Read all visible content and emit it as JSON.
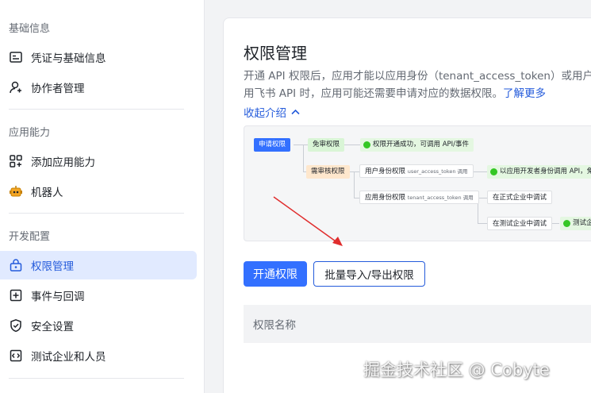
{
  "sidebar": {
    "sections": [
      {
        "title": "基础信息",
        "items": [
          {
            "label": "凭证与基础信息",
            "icon": "credential-icon"
          },
          {
            "label": "协作者管理",
            "icon": "user-add-icon"
          }
        ]
      },
      {
        "title": "应用能力",
        "items": [
          {
            "label": "添加应用能力",
            "icon": "grid-add-icon"
          },
          {
            "label": "机器人",
            "icon": "robot-icon"
          }
        ]
      },
      {
        "title": "开发配置",
        "items": [
          {
            "label": "权限管理",
            "icon": "lock-icon",
            "active": true
          },
          {
            "label": "事件与回调",
            "icon": "event-icon"
          },
          {
            "label": "安全设置",
            "icon": "shield-icon"
          },
          {
            "label": "测试企业和人员",
            "icon": "code-icon"
          }
        ]
      }
    ]
  },
  "main": {
    "title": "权限管理",
    "desc_line1": "开通 API 权限后，应用才能以应用身份（tenant_access_token）或用户",
    "desc_line2": "用飞书 API 时，应用可能还需要申请对应的数据权限。",
    "learn_more": "了解更多",
    "collapse_label": "收起介绍",
    "flow": {
      "apply": "申请权限",
      "no_review": "免审权限",
      "no_review_result": "权限开通成功，可调用 API/事件",
      "need_review": "需审核权限",
      "user_identity": "用户身份权限",
      "user_token": "user_access_token 调用",
      "user_result": "以应用开发者身份调用 API，免",
      "app_identity": "应用身份权限",
      "app_token": "tenant_access_token 调用",
      "prod_debug": "在正式企业中调试",
      "test_debug": "在测试企业中调试",
      "test_result": "测试企"
    },
    "enable_button": "开通权限",
    "batch_button": "批量导入/导出权限",
    "table_header": "权限名称"
  },
  "watermark": "掘金技术社区 @ Cobyte",
  "colors": {
    "accent": "#3370ff",
    "active_bg": "#e1eaff",
    "arrow": "#e02d2d"
  }
}
